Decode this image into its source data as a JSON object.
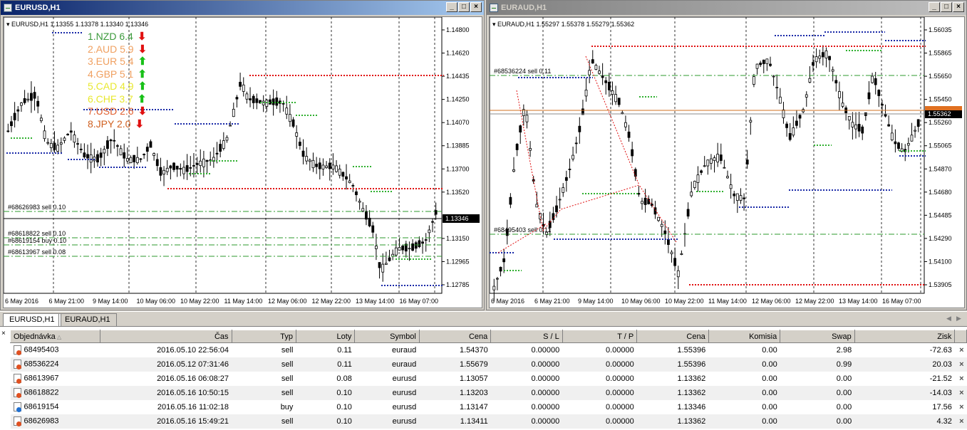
{
  "windows": [
    {
      "title": "EURUSD,H1",
      "header": "EURUSD,H1  1.13355 1.13378 1.13340 1.13346",
      "price_labels": [
        "1.14800",
        "1.14620",
        "1.14435",
        "1.14250",
        "1.14070",
        "1.13885",
        "1.13700",
        "1.13520",
        "1.13346",
        "1.13150",
        "1.12965",
        "1.12785"
      ],
      "current_price": "1.13346",
      "time_labels": [
        "6 May 2016",
        "6 May 21:00",
        "9 May 14:00",
        "10 May 06:00",
        "10 May 22:00",
        "11 May 14:00",
        "12 May 06:00",
        "12 May 22:00",
        "13 May 14:00",
        "16 May 07:00"
      ],
      "order_labels": [
        "#68626983 sell 0.10",
        "#68618822 sell 0.10",
        "#68619154 buy 0.10",
        "#68613967 sell 0.08"
      ],
      "strength": [
        {
          "label": "1.NZD  6.4",
          "color": "#3c9a3c",
          "dir": "down"
        },
        {
          "label": "2.AUD  5.9",
          "color": "#f0a060",
          "dir": "down"
        },
        {
          "label": "3.EUR  5.4",
          "color": "#f0a060",
          "dir": "up"
        },
        {
          "label": "4.GBP  5.1",
          "color": "#f0a060",
          "dir": "up"
        },
        {
          "label": "5.CAD  4.9",
          "color": "#e8e830",
          "dir": "up"
        },
        {
          "label": "6.CHF  3.7",
          "color": "#e8e830",
          "dir": "up"
        },
        {
          "label": "7.USD  2.6",
          "color": "#e06030",
          "dir": "down"
        },
        {
          "label": "8.JPY   2.0",
          "color": "#d06020",
          "dir": "down"
        }
      ]
    },
    {
      "title": "EURAUD,H1",
      "header": "EURAUD,H1  1.55297 1.55378 1.55279 1.55362",
      "price_labels": [
        "1.56035",
        "1.55865",
        "1.55650",
        "1.55450",
        "1.55260",
        "1.55065",
        "1.54870",
        "1.54680",
        "1.54485",
        "1.54290",
        "1.54100",
        "1.53905"
      ],
      "current_price": "1.55362",
      "time_labels": [
        "6 May 2016",
        "6 May 21:00",
        "9 May 14:00",
        "10 May 06:00",
        "10 May 22:00",
        "11 May 14:00",
        "12 May 06:00",
        "12 May 22:00",
        "13 May 14:00",
        "16 May 07:00"
      ],
      "order_labels": [
        "#68536224 sell 0.11",
        "#68495403 sell 0.11"
      ]
    }
  ],
  "tabs": [
    "EURUSD,H1",
    "EURAUD,H1"
  ],
  "table": {
    "headers": [
      "Objednávka",
      "Čas",
      "Typ",
      "Loty",
      "Symbol",
      "Cena",
      "S / L",
      "T / P",
      "Cena",
      "Komisia",
      "Swap",
      "Zisk"
    ],
    "rows": [
      [
        "68495403",
        "2016.05.10 22:56:04",
        "sell",
        "0.11",
        "euraud",
        "1.54370",
        "0.00000",
        "0.00000",
        "1.55396",
        "0.00",
        "2.98",
        "-72.63"
      ],
      [
        "68536224",
        "2016.05.12 07:31:46",
        "sell",
        "0.11",
        "euraud",
        "1.55679",
        "0.00000",
        "0.00000",
        "1.55396",
        "0.00",
        "0.99",
        "20.03"
      ],
      [
        "68613967",
        "2016.05.16 06:08:27",
        "sell",
        "0.08",
        "eurusd",
        "1.13057",
        "0.00000",
        "0.00000",
        "1.13362",
        "0.00",
        "0.00",
        "-21.52"
      ],
      [
        "68618822",
        "2016.05.16 10:50:15",
        "sell",
        "0.10",
        "eurusd",
        "1.13203",
        "0.00000",
        "0.00000",
        "1.13362",
        "0.00",
        "0.00",
        "-14.03"
      ],
      [
        "68619154",
        "2016.05.16 11:02:18",
        "buy",
        "0.10",
        "eurusd",
        "1.13147",
        "0.00000",
        "0.00000",
        "1.13346",
        "0.00",
        "0.00",
        "17.56"
      ],
      [
        "68626983",
        "2016.05.16 15:49:21",
        "sell",
        "0.10",
        "eurusd",
        "1.13411",
        "0.00000",
        "0.00000",
        "1.13362",
        "0.00",
        "0.00",
        "4.32"
      ]
    ]
  },
  "colors": {
    "up_arrow": "#18c018",
    "down_arrow": "#e01010",
    "active_title": "#0a246a"
  },
  "icons": {
    "close": "close-icon",
    "minimize": "minimize-icon",
    "maximize": "maximize-icon"
  }
}
